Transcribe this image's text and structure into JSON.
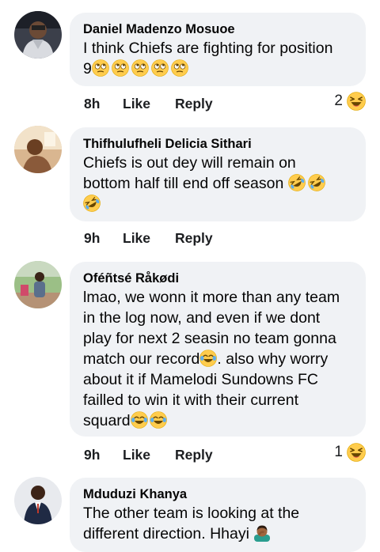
{
  "comments": [
    {
      "author": "Daniel Madenzo Mosuoe",
      "line1": "I think Chiefs are fighting for position",
      "line2_prefix": "9",
      "time": "8h",
      "like_label": "Like",
      "reply_label": "Reply",
      "reaction_count": "2",
      "emoji_names": [
        "rolling-eyes-icon",
        "laughing-icon"
      ]
    },
    {
      "author": "Thifhulufheli Delicia Sithari",
      "line1": "Chiefs is out dey will remain on",
      "line2": "bottom half till end off season",
      "time": "9h",
      "like_label": "Like",
      "reply_label": "Reply",
      "emoji_names": [
        "rolling-on-floor-laughing-icon"
      ]
    },
    {
      "author": "Oféñtsé Råkødi",
      "lines": [
        "lmao, we wonn it more than any team",
        "in the log now, and even if we dont",
        "play for next 2 seasin no team gonna",
        "match our record",
        ". also why worry",
        "about it if Mamelodi Sundowns FC",
        "failled to win it with their current",
        "squard"
      ],
      "time": "9h",
      "like_label": "Like",
      "reply_label": "Reply",
      "reaction_count": "1",
      "emoji_names": [
        "tears-of-joy-icon",
        "laughing-icon"
      ]
    },
    {
      "author": "Mduduzi Khanya",
      "line1": "The other team is looking at the",
      "line2": "different direction. Hhayi",
      "emoji_names": [
        "facepalm-icon"
      ]
    }
  ],
  "colors": {
    "bubble": "#f0f2f5",
    "text": "#050505",
    "emoji_yellow": "#ffcc4d"
  }
}
